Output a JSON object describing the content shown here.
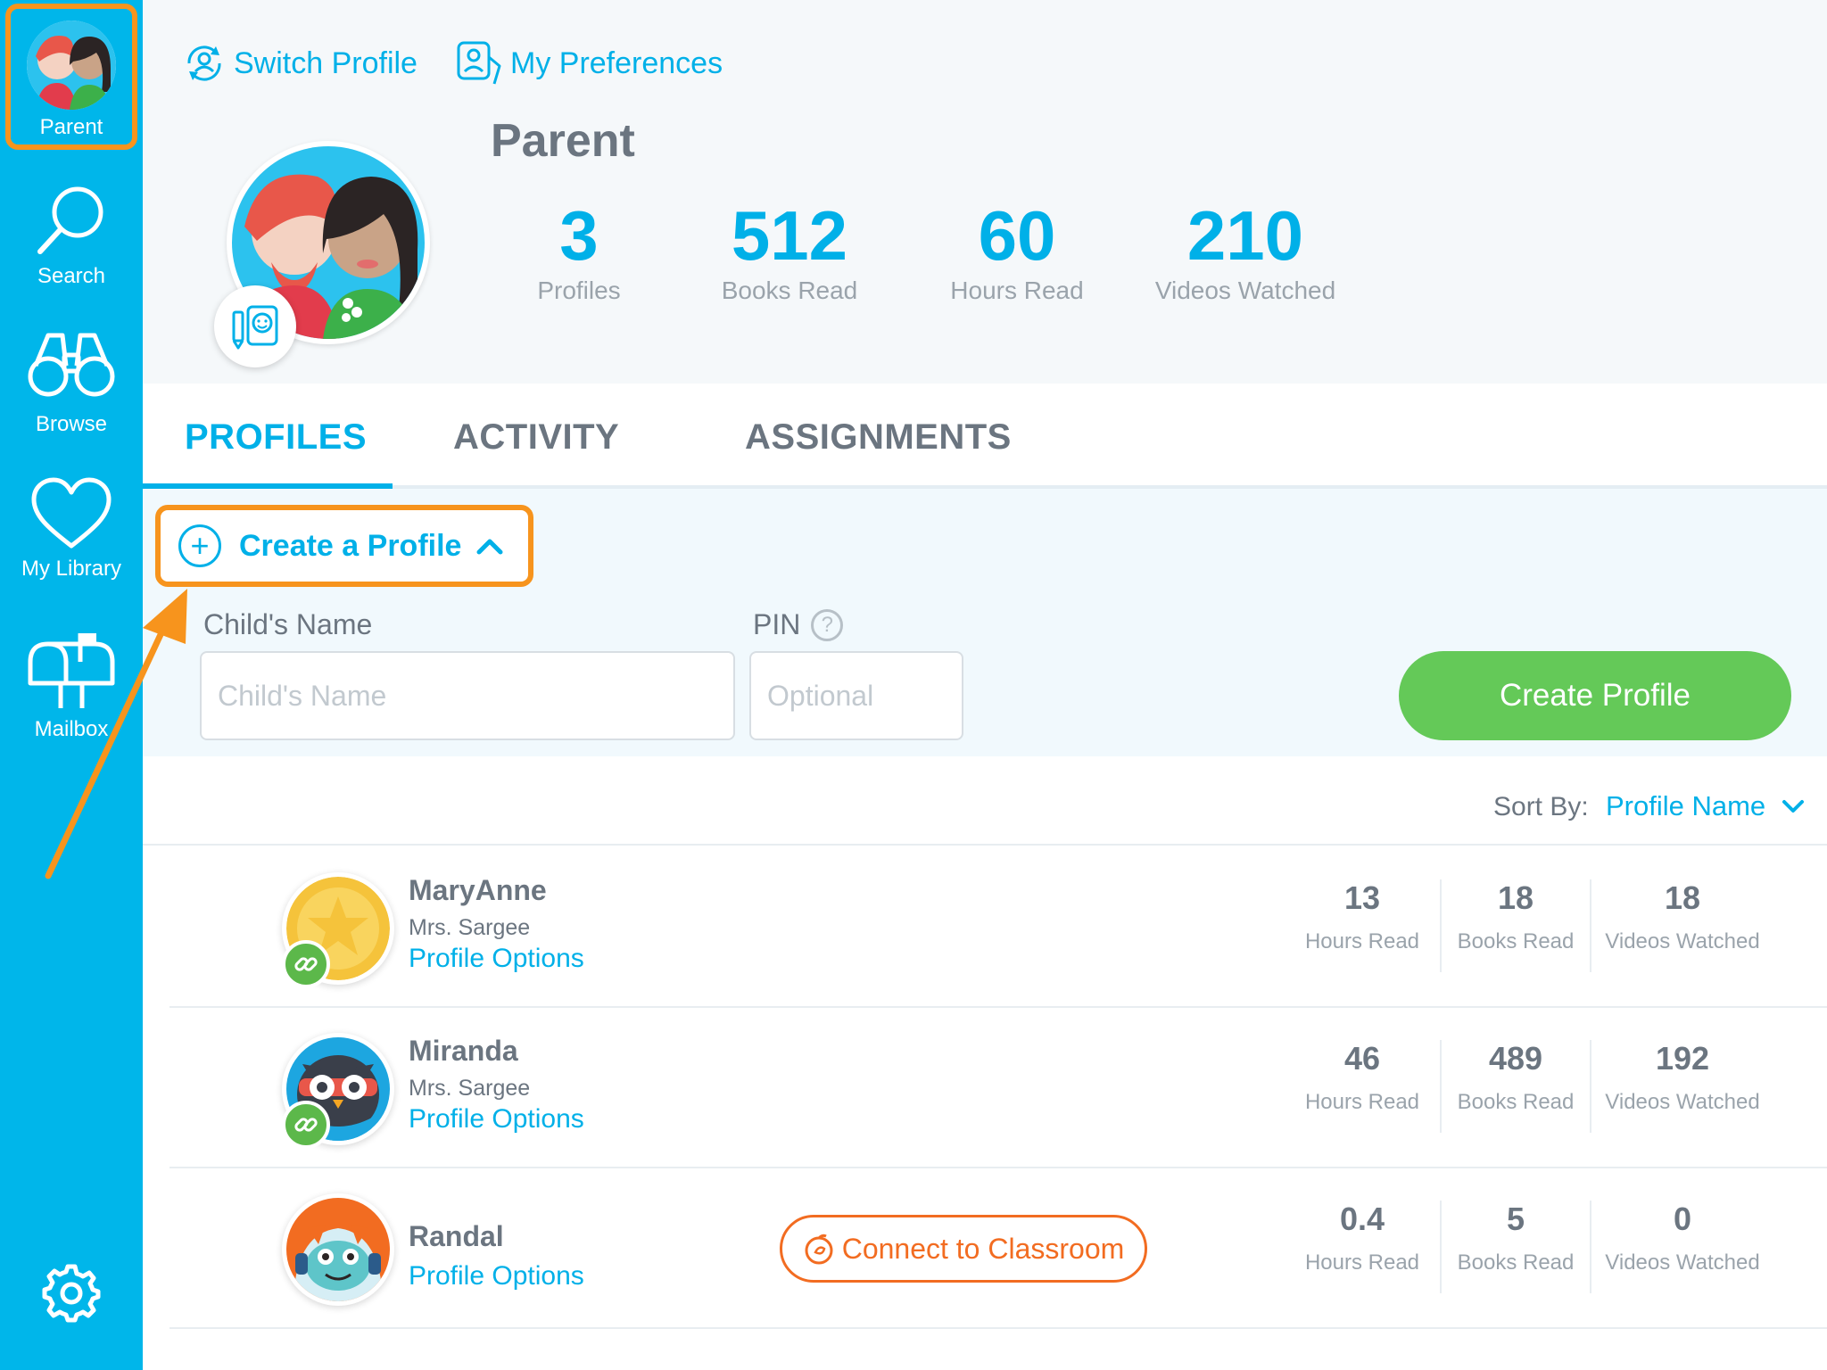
{
  "sidebar": {
    "items": [
      {
        "label": "Parent",
        "icon": "parent-avatar"
      },
      {
        "label": "Search",
        "icon": "search-icon"
      },
      {
        "label": "Browse",
        "icon": "binoculars-icon"
      },
      {
        "label": "My Library",
        "icon": "heart-icon"
      },
      {
        "label": "Mailbox",
        "icon": "mailbox-icon"
      }
    ],
    "settings_icon": "gear-icon"
  },
  "header": {
    "switch_profile": "Switch Profile",
    "my_preferences": "My Preferences",
    "name": "Parent",
    "stats": [
      {
        "value": "3",
        "label": "Profiles"
      },
      {
        "value": "512",
        "label": "Books Read"
      },
      {
        "value": "60",
        "label": "Hours Read"
      },
      {
        "value": "210",
        "label": "Videos Watched"
      }
    ]
  },
  "tabs": [
    {
      "label": "PROFILES",
      "active": true
    },
    {
      "label": "ACTIVITY",
      "active": false
    },
    {
      "label": "ASSIGNMENTS",
      "active": false
    }
  ],
  "create": {
    "toggle_label": "Create a Profile",
    "name_label": "Child's Name",
    "name_placeholder": "Child's Name",
    "name_value": "",
    "pin_label": "PIN",
    "pin_help": "?",
    "pin_placeholder": "Optional",
    "pin_value": "",
    "button": "Create Profile"
  },
  "sort": {
    "label": "Sort By:",
    "value": "Profile Name"
  },
  "profiles": [
    {
      "name": "MaryAnne",
      "teacher": "Mrs. Sargee",
      "options": "Profile Options",
      "linked": true,
      "stats": [
        {
          "value": "13",
          "label": "Hours Read"
        },
        {
          "value": "18",
          "label": "Books Read"
        },
        {
          "value": "18",
          "label": "Videos Watched"
        }
      ]
    },
    {
      "name": "Miranda",
      "teacher": "Mrs. Sargee",
      "options": "Profile Options",
      "linked": true,
      "stats": [
        {
          "value": "46",
          "label": "Hours Read"
        },
        {
          "value": "489",
          "label": "Books Read"
        },
        {
          "value": "192",
          "label": "Videos Watched"
        }
      ]
    },
    {
      "name": "Randal",
      "options": "Profile Options",
      "connect": "Connect to Classroom",
      "linked": false,
      "stats": [
        {
          "value": "0.4",
          "label": "Hours Read"
        },
        {
          "value": "5",
          "label": "Books Read"
        },
        {
          "value": "0",
          "label": "Videos Watched"
        }
      ]
    }
  ],
  "colors": {
    "sidebar": "#00b6ea",
    "accent": "#00b0e8",
    "highlight": "#f7941d",
    "create_button": "#64c958",
    "connect": "#f26c21",
    "link_badge": "#5cb84a"
  }
}
